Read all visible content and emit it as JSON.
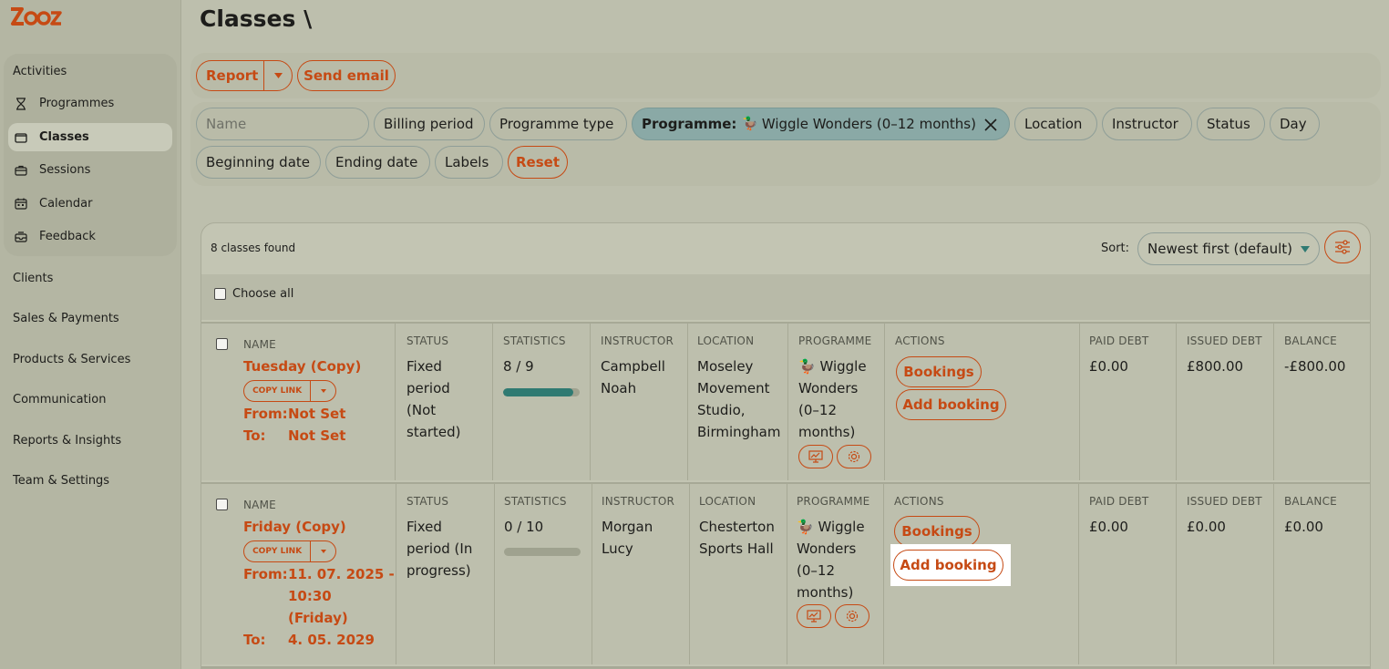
{
  "app": {
    "logo_text": "ZOOZ",
    "brand_color": "#c64a14"
  },
  "sidebar": {
    "group": "Activities",
    "sub_items": [
      {
        "label": "Programmes",
        "icon": "hourglass-icon"
      },
      {
        "label": "Classes",
        "icon": "folder-icon",
        "active": true
      },
      {
        "label": "Sessions",
        "icon": "briefcase-icon"
      },
      {
        "label": "Calendar",
        "icon": "calendar-icon"
      },
      {
        "label": "Feedback",
        "icon": "inbox-icon"
      }
    ],
    "items": [
      "Clients",
      "Sales & Payments",
      "Products & Services",
      "Communication",
      "Reports & Insights",
      "Team & Settings"
    ]
  },
  "page": {
    "title": "Classes \\"
  },
  "toolbar": {
    "report": "Report",
    "send_email": "Send email"
  },
  "filters": {
    "name_placeholder": "Name",
    "billing_period": "Billing period",
    "programme_type": "Programme type",
    "programme_label": "Programme:",
    "programme_value": "Wiggle Wonders (0–12 months)",
    "location": "Location",
    "instructor": "Instructor",
    "status": "Status",
    "day": "Day",
    "beginning_date": "Beginning date",
    "ending_date": "Ending date",
    "labels": "Labels",
    "reset": "Reset"
  },
  "results": {
    "count": "8 classes found",
    "sort_label": "Sort:",
    "sort_value": "Newest first (default)",
    "choose_all": "Choose all"
  },
  "columns": {
    "name": "NAME",
    "status": "STATUS",
    "statistics": "STATISTICS",
    "instructor": "INSTRUCTOR",
    "location": "LOCATION",
    "programme": "PROGRAMME",
    "actions": "ACTIONS",
    "paid_debt": "PAID DEBT",
    "issued_debt": "ISSUED DEBT",
    "balance": "BALANCE"
  },
  "labels": {
    "copy_link": "COPY LINK",
    "from": "From:",
    "to": "To:",
    "bookings": "Bookings",
    "add_booking": "Add booking"
  },
  "rows": [
    {
      "name": "Tuesday (Copy)",
      "from": "Not Set",
      "to": "Not Set",
      "status_lines": [
        "Fixed",
        "period",
        "(Not",
        "started)"
      ],
      "stats": "8 / 9",
      "progress": 0.92,
      "instructor_lines": [
        "Campbell",
        "Noah"
      ],
      "location_lines": [
        "Moseley",
        "Movement",
        "Studio,",
        "Birmingham"
      ],
      "programme_lines": [
        "Wiggle",
        "Wonders",
        "(0–12",
        "months)"
      ],
      "paid_debt": "£0.00",
      "issued_debt": "£800.00",
      "balance": "-£800.00"
    },
    {
      "name": "Friday (Copy)",
      "from_lines": [
        "11. 07. 2025 -",
        "10:30",
        "(Friday)"
      ],
      "to": "4. 05. 2029",
      "status_lines": [
        "Fixed",
        "period (In",
        "progress)"
      ],
      "stats": "0 / 10",
      "progress": 0,
      "instructor_lines": [
        "Morgan",
        "Lucy"
      ],
      "location_lines": [
        "Chesterton",
        "Sports Hall"
      ],
      "programme_lines": [
        "Wiggle",
        "Wonders",
        "(0–12",
        "months)"
      ],
      "paid_debt": "£0.00",
      "issued_debt": "£0.00",
      "balance": "£0.00"
    }
  ]
}
